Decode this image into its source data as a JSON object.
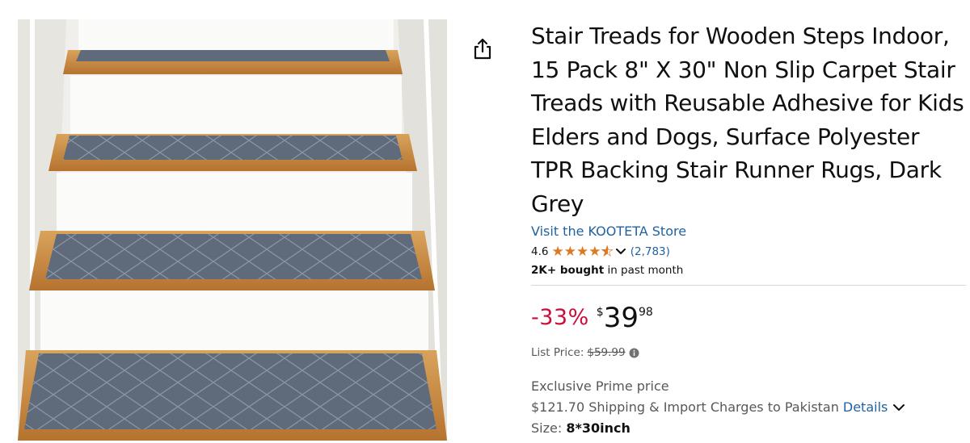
{
  "product": {
    "title": "Stair Treads for Wooden Steps Indoor, 15 Pack 8\" X 30\" Non Slip Carpet Stair Treads with Reusable Adhesive for Kids Elders and Dogs, Surface Polyester TPR Backing Stair Runner Rugs, Dark Grey",
    "store_link": "Visit the KOOTETA Store",
    "rating": "4.6",
    "rating_value": 4.6,
    "rating_count": "(2,783)",
    "bought_bold": "2K+ bought",
    "bought_rest": " in past month"
  },
  "price": {
    "discount": "-33%",
    "symbol": "$",
    "whole": "39",
    "fraction": "98",
    "list_label": "List Price:",
    "list_value": "$59.99"
  },
  "shipping": {
    "exclusive": "Exclusive Prime price",
    "charges": "$121.70 Shipping & Import Charges to Pakistan",
    "details_link": "Details"
  },
  "size": {
    "label": "Size:",
    "value": "8*30inch"
  },
  "icons": {
    "share": "share-icon",
    "star": "star-icon",
    "chevron": "chevron-down-icon",
    "info": "info-icon"
  },
  "colors": {
    "link": "#2162a1",
    "discount": "#cc0c39",
    "star": "#de7921",
    "text": "#0f1111",
    "muted": "#565959"
  }
}
